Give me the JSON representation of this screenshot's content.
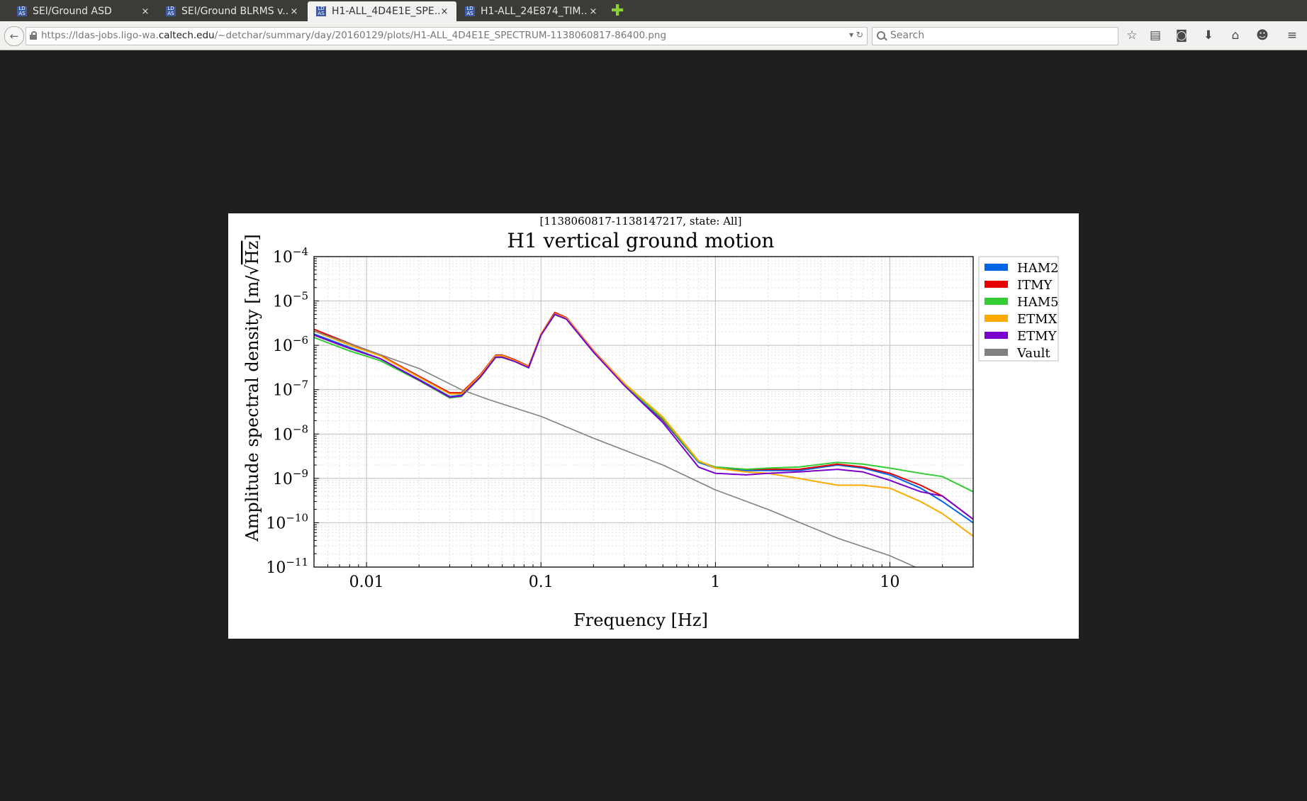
{
  "tabs": [
    {
      "title": "SEI/Ground ASD",
      "close": "×",
      "active": false
    },
    {
      "title": "SEI/Ground BLRMS v...",
      "close": "×",
      "active": false
    },
    {
      "title": "H1-ALL_4D4E1E_SPE...",
      "close": "×",
      "active": true
    },
    {
      "title": "H1-ALL_24E874_TIM...",
      "close": "×",
      "active": false
    }
  ],
  "favicon": "LD AS",
  "new_tab": "✚",
  "back": "←",
  "url": {
    "prefix": "https://ldas-jobs.ligo-wa.",
    "domain": "caltech.edu",
    "path": "/~detchar/summary/day/20160129/plots/H1-ALL_4D4E1E_SPECTRUM-1138060817-86400.png",
    "controls": "▾  ↻"
  },
  "search_placeholder": "Search",
  "toolbar": [
    {
      "name": "bookmark-star-icon",
      "glyph": "☆"
    },
    {
      "name": "reading-list-icon",
      "glyph": "▤"
    },
    {
      "name": "pocket-icon",
      "glyph": "◙"
    },
    {
      "name": "download-icon",
      "glyph": "⬇"
    },
    {
      "name": "home-icon",
      "glyph": "⌂"
    },
    {
      "name": "chat-icon",
      "glyph": "☻"
    },
    {
      "name": "menu-icon",
      "glyph": "≡"
    }
  ],
  "chart_data": {
    "type": "line",
    "subtitle": "[1138060817-1138147217, state: All]",
    "title": "H1 vertical ground motion",
    "xlabel": "Frequency [Hz]",
    "ylabel_prefix": "Amplitude spectral density [m/",
    "ylabel_root": "Hz",
    "ylabel_suffix": "]",
    "xscale": "log",
    "yscale": "log",
    "xlim": [
      0.005,
      30
    ],
    "ylim": [
      1e-11,
      0.0001
    ],
    "xticks": [
      {
        "v": 0.01,
        "label": "0.01"
      },
      {
        "v": 0.1,
        "label": "0.1"
      },
      {
        "v": 1,
        "label": "1"
      },
      {
        "v": 10,
        "label": "10"
      }
    ],
    "yticks": [
      {
        "v": 0.0001,
        "exp": "−4"
      },
      {
        "v": 1e-05,
        "exp": "−5"
      },
      {
        "v": 1e-06,
        "exp": "−6"
      },
      {
        "v": 1e-07,
        "exp": "−7"
      },
      {
        "v": 1e-08,
        "exp": "−8"
      },
      {
        "v": 1e-09,
        "exp": "−9"
      },
      {
        "v": 1e-10,
        "exp": "−10"
      },
      {
        "v": 1e-11,
        "exp": "−11"
      }
    ],
    "grid": true,
    "legend_position": "outside-right",
    "series": [
      {
        "name": "HAM2",
        "color": "#0066e6",
        "x": [
          0.005,
          0.008,
          0.012,
          0.02,
          0.03,
          0.035,
          0.045,
          0.055,
          0.06,
          0.07,
          0.085,
          0.1,
          0.12,
          0.14,
          0.2,
          0.3,
          0.5,
          0.8,
          1,
          1.5,
          2,
          3,
          5,
          7,
          10,
          15,
          20,
          30
        ],
        "y": [
          1.8e-06,
          9e-07,
          5e-07,
          1.7e-07,
          7e-08,
          7.5e-08,
          2e-07,
          5.5e-07,
          5.5e-07,
          4.5e-07,
          3.2e-07,
          1.7e-06,
          5e-06,
          4e-06,
          7e-07,
          1.3e-07,
          2e-08,
          2.3e-09,
          1.7e-09,
          1.5e-09,
          1.5e-09,
          1.5e-09,
          2e-09,
          1.7e-09,
          1.2e-09,
          6e-10,
          3e-10,
          1e-10
        ]
      },
      {
        "name": "ITMY",
        "color": "#e60000",
        "x": [
          0.005,
          0.008,
          0.012,
          0.02,
          0.03,
          0.035,
          0.045,
          0.055,
          0.06,
          0.07,
          0.085,
          0.1,
          0.12,
          0.14,
          0.2,
          0.3,
          0.5,
          0.8,
          1,
          1.5,
          2,
          3,
          5,
          7,
          10,
          15,
          20,
          30
        ],
        "y": [
          2.3e-06,
          1.1e-06,
          6e-07,
          2e-07,
          8.5e-08,
          8.5e-08,
          2.2e-07,
          6e-07,
          6e-07,
          4.8e-07,
          3.4e-07,
          1.8e-06,
          5.5e-06,
          4.2e-06,
          7.5e-07,
          1.4e-07,
          2.1e-08,
          2.4e-09,
          1.8e-09,
          1.6e-09,
          1.6e-09,
          1.6e-09,
          2.1e-09,
          1.8e-09,
          1.3e-09,
          7e-10,
          4e-10,
          1.2e-10
        ]
      },
      {
        "name": "HAM5",
        "color": "#33cc33",
        "x": [
          0.005,
          0.008,
          0.012,
          0.02,
          0.03,
          0.035,
          0.045,
          0.055,
          0.06,
          0.07,
          0.085,
          0.1,
          0.12,
          0.14,
          0.2,
          0.3,
          0.5,
          0.8,
          1,
          1.5,
          2,
          3,
          5,
          7,
          10,
          15,
          20,
          30
        ],
        "y": [
          1.5e-06,
          7.5e-07,
          4.5e-07,
          1.6e-07,
          6.5e-08,
          7e-08,
          1.9e-07,
          5.3e-07,
          5.3e-07,
          4.4e-07,
          3.1e-07,
          1.7e-06,
          4.9e-06,
          3.9e-06,
          7e-07,
          1.3e-07,
          2.2e-08,
          2.4e-09,
          1.8e-09,
          1.6e-09,
          1.7e-09,
          1.8e-09,
          2.3e-09,
          2.1e-09,
          1.7e-09,
          1.3e-09,
          1.1e-09,
          5e-10
        ]
      },
      {
        "name": "ETMX",
        "color": "#ffaa00",
        "x": [
          0.005,
          0.008,
          0.012,
          0.02,
          0.03,
          0.035,
          0.045,
          0.055,
          0.06,
          0.07,
          0.085,
          0.1,
          0.12,
          0.14,
          0.2,
          0.3,
          0.5,
          0.8,
          1,
          1.5,
          2,
          3,
          5,
          7,
          10,
          15,
          20,
          30
        ],
        "y": [
          2.1e-06,
          1e-06,
          5.8e-07,
          1.9e-07,
          8e-08,
          8e-08,
          2.1e-07,
          5.8e-07,
          5.8e-07,
          4.6e-07,
          3.3e-07,
          1.8e-06,
          5.2e-06,
          4.1e-06,
          7.3e-07,
          1.4e-07,
          2.4e-08,
          2.5e-09,
          1.7e-09,
          1.4e-09,
          1.3e-09,
          1e-09,
          7e-10,
          7e-10,
          6e-10,
          3e-10,
          1.6e-10,
          5e-11
        ]
      },
      {
        "name": "ETMY",
        "color": "#7a00cc",
        "x": [
          0.005,
          0.008,
          0.012,
          0.02,
          0.03,
          0.035,
          0.045,
          0.055,
          0.06,
          0.07,
          0.085,
          0.1,
          0.12,
          0.14,
          0.2,
          0.3,
          0.5,
          0.8,
          1,
          1.5,
          2,
          3,
          5,
          7,
          10,
          15,
          20,
          30
        ],
        "y": [
          1.7e-06,
          8.5e-07,
          5e-07,
          1.65e-07,
          6.8e-08,
          7.2e-08,
          1.95e-07,
          5.4e-07,
          5.4e-07,
          4.4e-07,
          3.15e-07,
          1.7e-06,
          5e-06,
          3.9e-06,
          7e-07,
          1.25e-07,
          1.8e-08,
          1.8e-09,
          1.3e-09,
          1.2e-09,
          1.3e-09,
          1.4e-09,
          1.6e-09,
          1.4e-09,
          9e-10,
          5e-10,
          4e-10,
          1.2e-10
        ]
      },
      {
        "name": "Vault",
        "color": "#808080",
        "x": [
          0.005,
          0.01,
          0.02,
          0.035,
          0.05,
          0.1,
          0.2,
          0.5,
          1,
          2,
          5,
          10,
          14
        ],
        "y": [
          2.1e-06,
          8e-07,
          3e-07,
          1e-07,
          6e-08,
          2.5e-08,
          8e-09,
          2e-09,
          5.5e-10,
          2e-10,
          4.5e-11,
          1.8e-11,
          1e-11
        ]
      }
    ]
  }
}
